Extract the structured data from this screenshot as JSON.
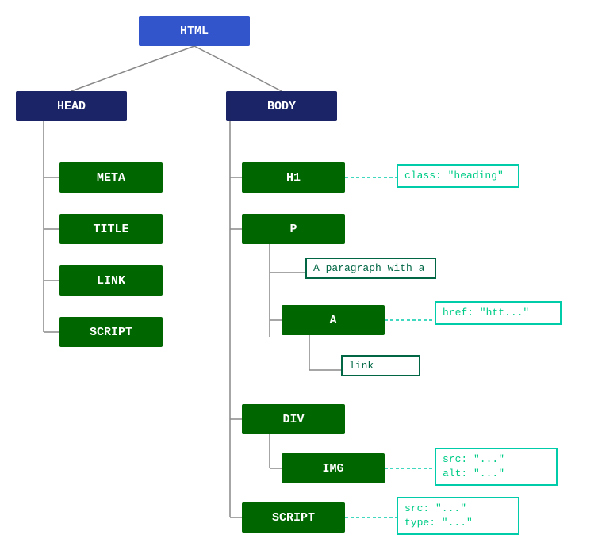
{
  "nodes": {
    "html": {
      "label": "HTML"
    },
    "head": {
      "label": "HEAD"
    },
    "body": {
      "label": "BODY"
    },
    "meta": {
      "label": "META"
    },
    "title": {
      "label": "TITLE"
    },
    "link": {
      "label": "LINK"
    },
    "script_head": {
      "label": "SCRIPT"
    },
    "h1": {
      "label": "H1"
    },
    "p": {
      "label": "P"
    },
    "div": {
      "label": "DIV"
    },
    "img": {
      "label": "IMG"
    },
    "script_body": {
      "label": "SCRIPT"
    },
    "a": {
      "label": "A"
    }
  },
  "attrs": {
    "h1": "class: \"heading\"",
    "a": "href: \"htt...\"",
    "text_p": "A paragraph with a",
    "link_text": "link",
    "img": "src: \"...\"\nalt: \"...\"",
    "script_body": "src: \"...\"\ntype: \"...\""
  }
}
